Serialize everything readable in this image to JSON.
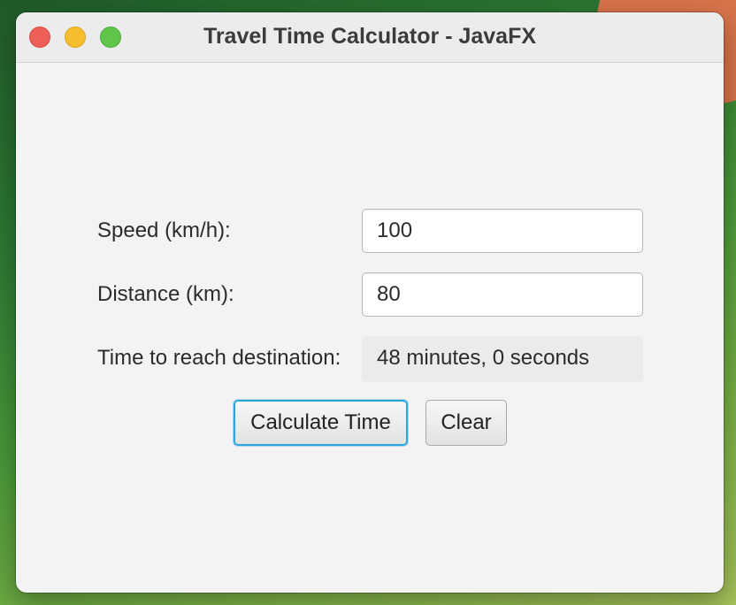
{
  "window": {
    "title": "Travel Time Calculator - JavaFX"
  },
  "form": {
    "speed": {
      "label": "Speed (km/h):",
      "value": "100"
    },
    "distance": {
      "label": "Distance (km):",
      "value": "80"
    },
    "result": {
      "label": "Time to reach destination:",
      "value": "48 minutes, 0 seconds"
    }
  },
  "buttons": {
    "calculate_label": "Calculate Time",
    "clear_label": "Clear"
  },
  "colors": {
    "close": "#ee5f57",
    "minimize": "#f6be2f",
    "maximize": "#5fc64a",
    "focus_accent": "#2fa6db"
  }
}
